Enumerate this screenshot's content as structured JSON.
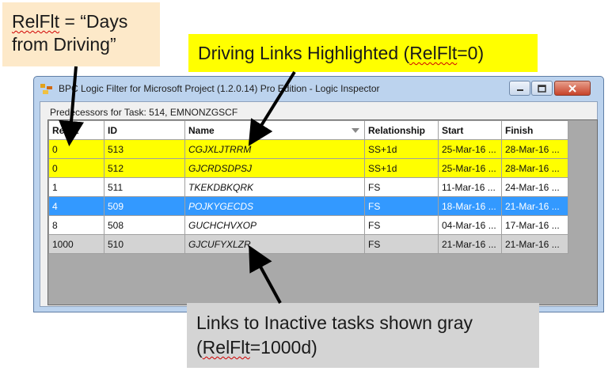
{
  "callouts": {
    "relflt_line1_a": "RelFlt",
    "relflt_line1_b": " = “Days",
    "relflt_line2": "from Driving”",
    "driving_a": "Driving Links Highlighted (",
    "driving_b": "RelFlt",
    "driving_c": "=0)",
    "inactive_line1": "Links to Inactive tasks shown gray",
    "inactive_line2_a": "(",
    "inactive_line2_b": "RelFlt",
    "inactive_line2_c": "=1000d)"
  },
  "window": {
    "title": "BPC Logic Filter for Microsoft Project  (1.2.0.14)  Pro Edition - Logic Inspector",
    "predecessors_label": "Predecessors for Task: 514, EMNONZGSCF"
  },
  "table": {
    "columns": [
      "RelFlt",
      "ID",
      "Name",
      "Relationship",
      "Start",
      "Finish"
    ],
    "rows": [
      {
        "relflt": "0",
        "id": "513",
        "name": "CGJXLJTRRM",
        "relationship": "SS+1d",
        "start": "25-Mar-16 ...",
        "finish": "28-Mar-16 ...",
        "style": "yellow"
      },
      {
        "relflt": "0",
        "id": "512",
        "name": "GJCRDSDPSJ",
        "relationship": "SS+1d",
        "start": "25-Mar-16 ...",
        "finish": "28-Mar-16 ...",
        "style": "yellow"
      },
      {
        "relflt": "1",
        "id": "511",
        "name": "TKEKDBKQRK",
        "relationship": "FS",
        "start": "11-Mar-16 ...",
        "finish": "24-Mar-16 ...",
        "style": "white"
      },
      {
        "relflt": "4",
        "id": "509",
        "name": "POJKYGECDS",
        "relationship": "FS",
        "start": "18-Mar-16 ...",
        "finish": "21-Mar-16 ...",
        "style": "blue"
      },
      {
        "relflt": "8",
        "id": "508",
        "name": "GUCHCHVXOP",
        "relationship": "FS",
        "start": "04-Mar-16 ...",
        "finish": "17-Mar-16 ...",
        "style": "white"
      },
      {
        "relflt": "1000",
        "id": "510",
        "name": "GJCUFYXLZR",
        "relationship": "FS",
        "start": "21-Mar-16 ...",
        "finish": "21-Mar-16 ...",
        "style": "gray"
      }
    ]
  },
  "colors": {
    "highlight_yellow": "#ffff00",
    "selected_blue": "#3399ff",
    "inactive_gray": "#d3d3d3"
  }
}
